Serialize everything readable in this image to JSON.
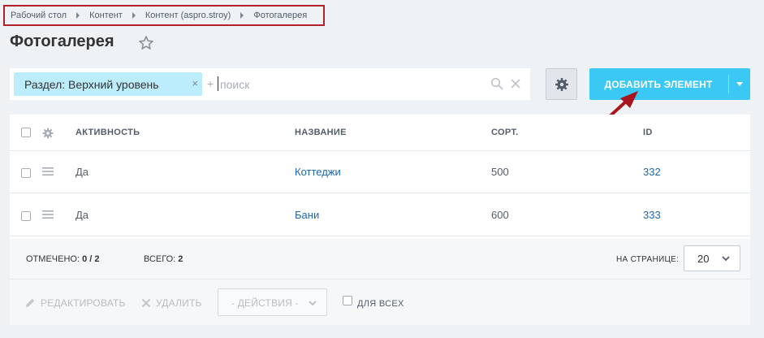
{
  "breadcrumb": [
    "Рабочий стол",
    "Контент",
    "Контент (aspro.stroy)",
    "Фотогалерея"
  ],
  "title": "Фотогалерея",
  "filter": {
    "chip_label": "Раздел: Верхний уровень",
    "chip_close": "×",
    "plus": "+",
    "placeholder": "поиск",
    "value": ""
  },
  "add_button": {
    "label": "ДОБАВИТЬ ЭЛЕМЕНТ"
  },
  "grid": {
    "columns": [
      "АКТИВНОСТЬ",
      "НАЗВАНИЕ",
      "СОРТ.",
      "ID"
    ],
    "rows": [
      {
        "active": "Да",
        "name": "Коттеджи",
        "sort": "500",
        "id": "332"
      },
      {
        "active": "Да",
        "name": "Бани",
        "sort": "600",
        "id": "333"
      }
    ]
  },
  "footer": {
    "checked_label": "ОТМЕЧЕНО:",
    "checked_value": "0 / 2",
    "total_label": "ВСЕГО:",
    "total_value": "2",
    "per_page_label": "НА СТРАНИЦЕ:",
    "per_page_value": "20"
  },
  "actions": {
    "edit": "РЕДАКТИРОВАТЬ",
    "delete": "УДАЛИТЬ",
    "select": "- ДЕЙСТВИЯ -",
    "for_all": "ДЛЯ ВСЕХ"
  },
  "colors": {
    "accent": "#3bc8f5",
    "chip": "#bcedfc",
    "link": "#2067b0",
    "highlight_frame": "#b0222a",
    "arrow": "#a8151c"
  },
  "icons": [
    "star-icon",
    "search-icon",
    "clear-icon",
    "gear-icon",
    "chevron-down-icon",
    "drag-handle-icon",
    "pencil-icon",
    "delete-x-icon"
  ]
}
